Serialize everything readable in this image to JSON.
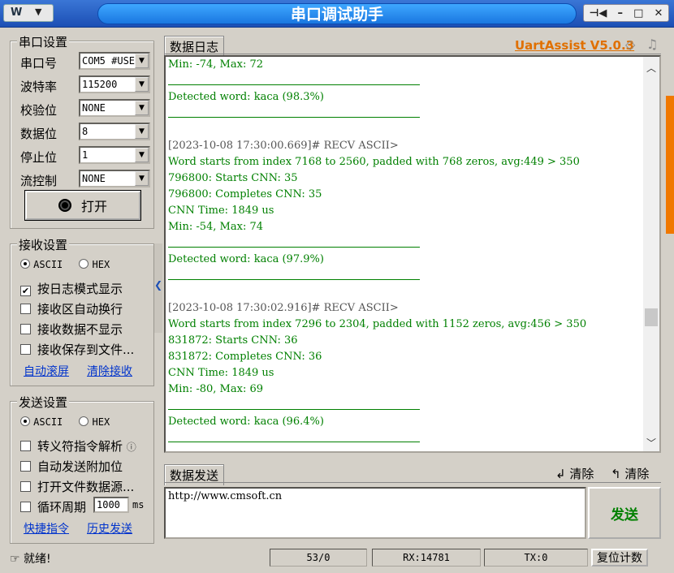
{
  "window": {
    "title": "串口调试助手",
    "menu_icon": "W"
  },
  "left": {
    "serial_group": "串口设置",
    "fields": [
      {
        "label": "串口号",
        "value": "COM5 #USE"
      },
      {
        "label": "波特率",
        "value": "115200"
      },
      {
        "label": "校验位",
        "value": "NONE"
      },
      {
        "label": "数据位",
        "value": "8"
      },
      {
        "label": "停止位",
        "value": "1"
      },
      {
        "label": "流控制",
        "value": "NONE"
      }
    ],
    "open_button": "打开",
    "recv_group": "接收设置",
    "recv_ascii": "ASCII",
    "recv_hex": "HEX",
    "recv_opts": [
      "按日志模式显示",
      "接收区自动换行",
      "接收数据不显示",
      "接收保存到文件..."
    ],
    "recv_links": [
      "自动滚屏",
      "清除接收"
    ],
    "send_group": "发送设置",
    "send_ascii": "ASCII",
    "send_hex": "HEX",
    "send_opts": [
      "转义符指令解析",
      "自动发送附加位",
      "打开文件数据源..."
    ],
    "cycle_label": "循环周期",
    "cycle_value": "1000",
    "cycle_unit": "ms",
    "send_links": [
      "快捷指令",
      "历史发送"
    ]
  },
  "log": {
    "tab": "数据日志",
    "brand": "UartAssist V5.0.3",
    "lines": [
      {
        "t": "Min: -74,   Max: 72"
      },
      {
        "t": "",
        "rule": true
      },
      {
        "t": "Detected word: kaca (98.3%)"
      },
      {
        "t": "",
        "rule": true
      },
      {
        "t": ""
      },
      {
        "t": "[2023-10-08 17:30:00.669]# RECV ASCII>",
        "hdr": true
      },
      {
        "t": "Word starts from index 7168 to 2560, padded with 768 zeros, avg:449 > 350"
      },
      {
        "t": "796800: Starts CNN: 35"
      },
      {
        "t": "796800: Completes CNN: 35"
      },
      {
        "t": "CNN Time: 1849 us"
      },
      {
        "t": "Min: -54,   Max: 74"
      },
      {
        "t": "",
        "rule": true
      },
      {
        "t": "Detected word: kaca (97.9%)"
      },
      {
        "t": "",
        "rule": true
      },
      {
        "t": ""
      },
      {
        "t": "[2023-10-08 17:30:02.916]# RECV ASCII>",
        "hdr": true
      },
      {
        "t": "Word starts from index 7296 to 2304, padded with 1152 zeros, avg:456 > 350"
      },
      {
        "t": "831872: Starts CNN: 36"
      },
      {
        "t": "831872: Completes CNN: 36"
      },
      {
        "t": "CNN Time: 1849 us"
      },
      {
        "t": "Min: -80,   Max: 69"
      },
      {
        "t": "",
        "rule": true
      },
      {
        "t": "Detected word: kaca (96.4%)"
      },
      {
        "t": "",
        "rule": true
      }
    ]
  },
  "send": {
    "tab": "数据发送",
    "clear1": "清除",
    "clear2": "清除",
    "text": "http://www.cmsoft.cn",
    "button": "发送"
  },
  "status": {
    "ready": "就绪!",
    "count": "53/0",
    "rx": "RX:14781",
    "tx": "TX:0",
    "reset": "复位计数"
  },
  "colors": {
    "log_text": "#008000",
    "brand": "#e07000",
    "title_bar": "#1a77e0"
  }
}
